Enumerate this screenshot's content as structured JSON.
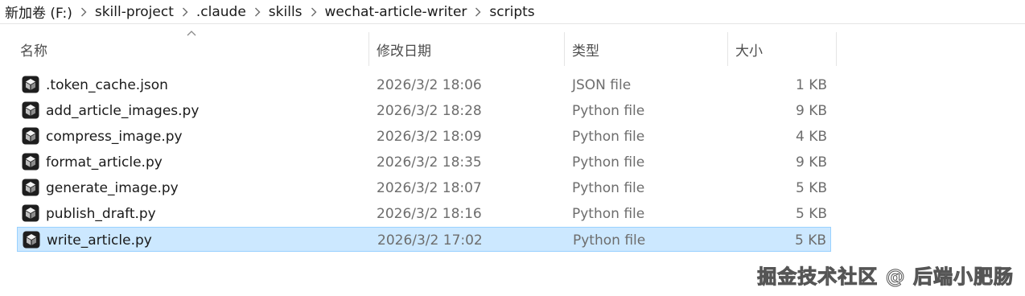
{
  "breadcrumb": {
    "items": [
      {
        "label": "新加卷 (F:)"
      },
      {
        "label": "skill-project"
      },
      {
        "label": ".claude"
      },
      {
        "label": "skills"
      },
      {
        "label": "wechat-article-writer"
      },
      {
        "label": "scripts"
      }
    ]
  },
  "columns": {
    "name": "名称",
    "date": "修改日期",
    "type": "类型",
    "size": "大小"
  },
  "files": [
    {
      "name": ".token_cache.json",
      "date": "2026/3/2 18:06",
      "type": "JSON file",
      "size": "1 KB",
      "selected": false
    },
    {
      "name": "add_article_images.py",
      "date": "2026/3/2 18:28",
      "type": "Python file",
      "size": "9 KB",
      "selected": false
    },
    {
      "name": "compress_image.py",
      "date": "2026/3/2 18:09",
      "type": "Python file",
      "size": "4 KB",
      "selected": false
    },
    {
      "name": "format_article.py",
      "date": "2026/3/2 18:35",
      "type": "Python file",
      "size": "9 KB",
      "selected": false
    },
    {
      "name": "generate_image.py",
      "date": "2026/3/2 18:07",
      "type": "Python file",
      "size": "5 KB",
      "selected": false
    },
    {
      "name": "publish_draft.py",
      "date": "2026/3/2 18:16",
      "type": "Python file",
      "size": "5 KB",
      "selected": false
    },
    {
      "name": "write_article.py",
      "date": "2026/3/2 17:02",
      "type": "Python file",
      "size": "5 KB",
      "selected": true
    }
  ],
  "watermark": "掘金技术社区 @ 后端小肥肠",
  "colors": {
    "selection_bg": "#cce8ff",
    "selection_border": "#99d1ff"
  }
}
